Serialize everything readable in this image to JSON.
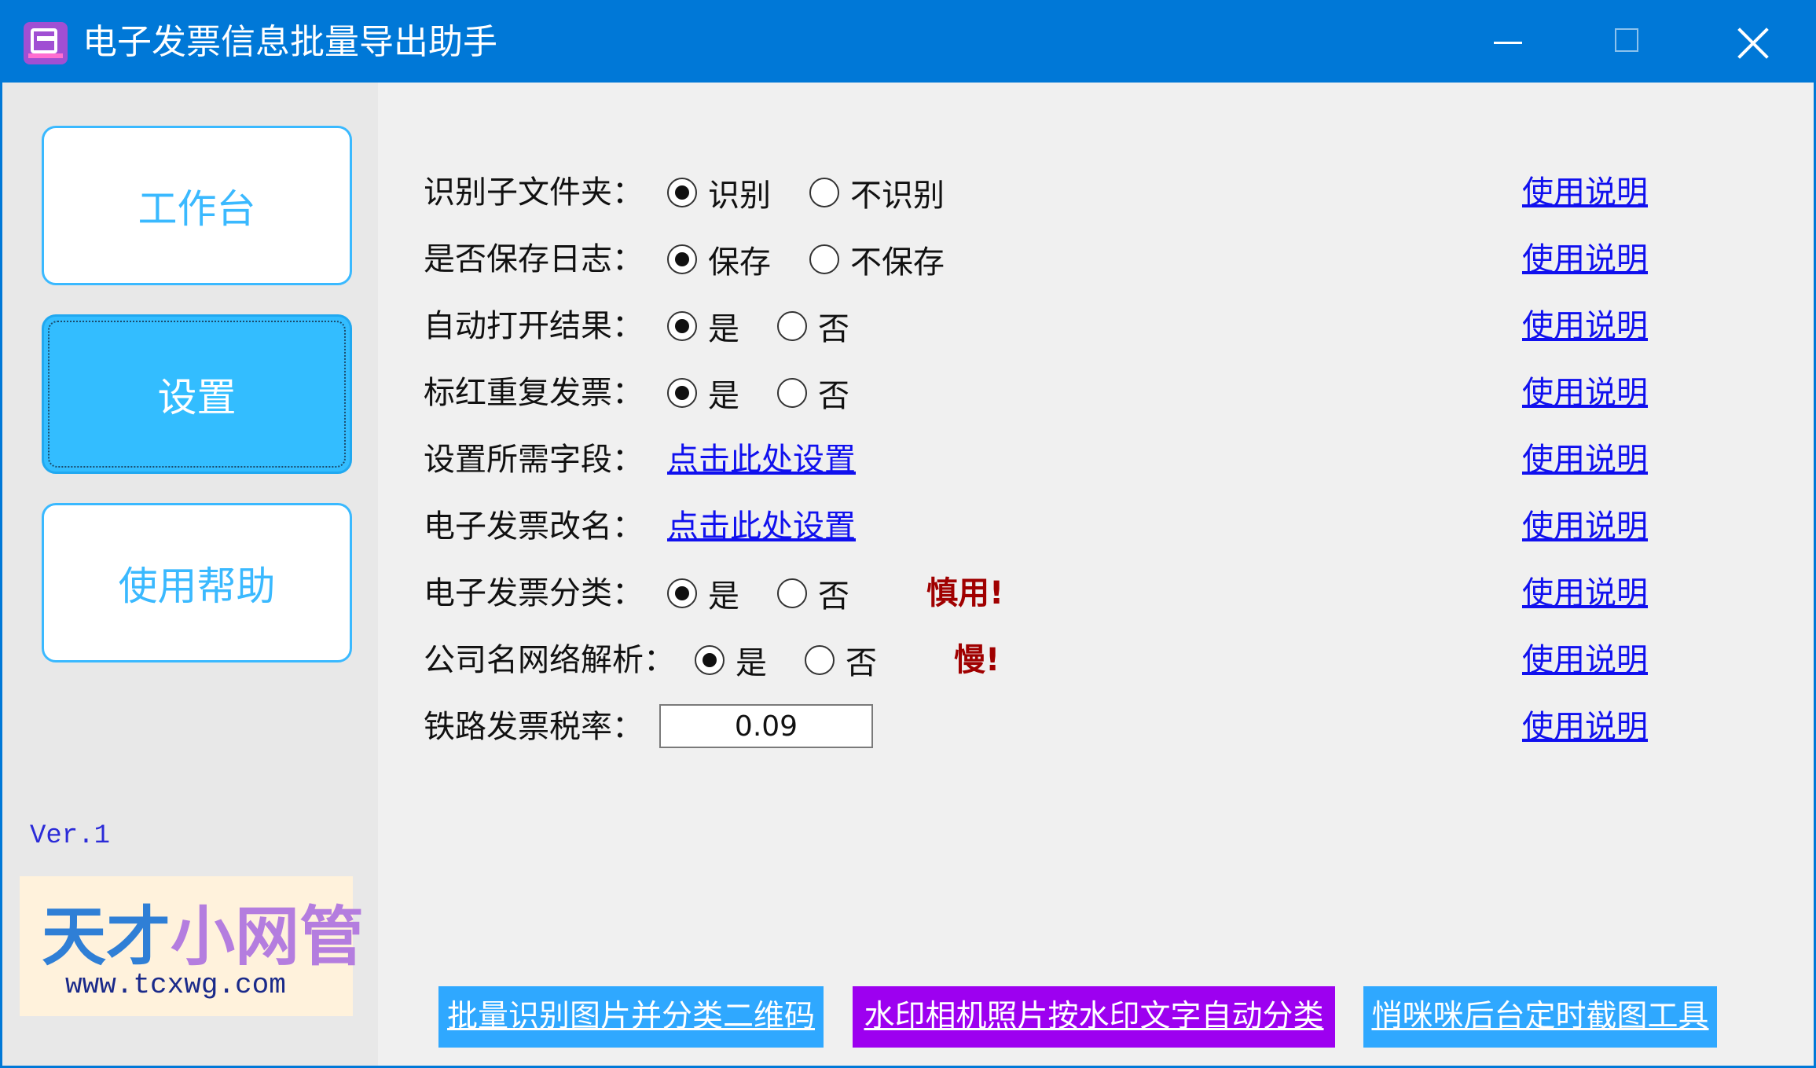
{
  "window": {
    "title": "电子发票信息批量导出助手",
    "colors": {
      "titlebar": "#0078d7",
      "accent": "#33bdff",
      "link": "#1010ee",
      "warning": "#a00000",
      "purple": "#9d00f0"
    }
  },
  "sidebar": {
    "items": [
      {
        "label": "工作台",
        "active": false
      },
      {
        "label": "设置",
        "active": true
      },
      {
        "label": "使用帮助",
        "active": false
      }
    ],
    "version": "Ver.1",
    "logo": {
      "text_a": "天才",
      "text_b": "小网管",
      "url": "www.tcxwg.com"
    }
  },
  "settings": {
    "help_label": "使用说明",
    "rows": [
      {
        "label": "识别子文件夹：",
        "options": [
          "识别",
          "不识别"
        ],
        "selected": 0
      },
      {
        "label": "是否保存日志：",
        "options": [
          "保存",
          "不保存"
        ],
        "selected": 0
      },
      {
        "label": "自动打开结果：",
        "options": [
          "是",
          "否"
        ],
        "selected": 0
      },
      {
        "label": "标红重复发票：",
        "options": [
          "是",
          "否"
        ],
        "selected": 0
      },
      {
        "label": "设置所需字段：",
        "link": "点击此处设置"
      },
      {
        "label": "电子发票改名：",
        "link": "点击此处设置"
      },
      {
        "label": "电子发票分类：",
        "options": [
          "是",
          "否"
        ],
        "selected": 0,
        "warning": "慎用!"
      },
      {
        "label": "公司名网络解析：",
        "options": [
          "是",
          "否"
        ],
        "selected": 0,
        "warning": "慢!"
      },
      {
        "label": "铁路发票税率：",
        "value": "0.09"
      }
    ]
  },
  "bottom_links": [
    "批量识别图片并分类二维码",
    "水印相机照片按水印文字自动分类",
    "悄咪咪后台定时截图工具"
  ]
}
